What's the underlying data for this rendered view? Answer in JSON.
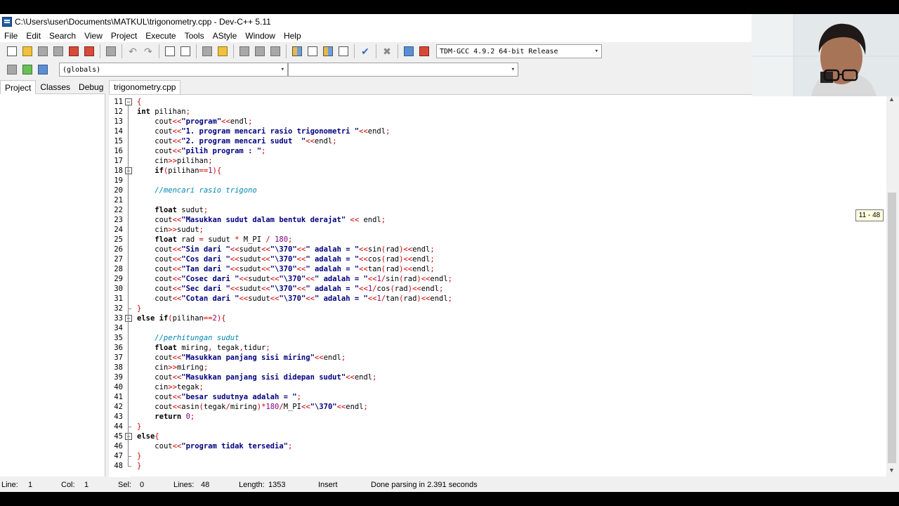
{
  "window": {
    "title": "C:\\Users\\user\\Documents\\MATKUL\\trigonometry.cpp - Dev-C++ 5.11"
  },
  "menu": [
    "File",
    "Edit",
    "Search",
    "View",
    "Project",
    "Execute",
    "Tools",
    "AStyle",
    "Window",
    "Help"
  ],
  "toolbar": {
    "compiler": "TDM-GCC 4.9.2 64-bit Release",
    "scope": "(globals)",
    "member": ""
  },
  "left_tabs": [
    "Project",
    "Classes",
    "Debug"
  ],
  "editor_tab": "trigonometry.cpp",
  "tooltip": "11 - 48",
  "colors": {
    "keyword": "#000000",
    "string": "#00007f",
    "number": "#7f007f",
    "comment": "#0086b3",
    "symbol": "#cc0000",
    "text": "#000000"
  },
  "code": [
    {
      "n": "11",
      "t": "{"
    },
    {
      "n": "12",
      "t": "int pilihan;"
    },
    {
      "n": "13",
      "t": "    cout<<\"program\"<<endl;"
    },
    {
      "n": "14",
      "t": "    cout<<\"1. program mencari rasio trigonometri \"<<endl;"
    },
    {
      "n": "15",
      "t": "    cout<<\"2. program mencari sudut  \"<<endl;"
    },
    {
      "n": "16",
      "t": "    cout<<\"pilih program : \";"
    },
    {
      "n": "17",
      "t": "    cin>>pilihan;"
    },
    {
      "n": "18",
      "t": "    if(pilihan==1){"
    },
    {
      "n": "19",
      "t": ""
    },
    {
      "n": "20",
      "t": "    //mencari rasio trigono"
    },
    {
      "n": "21",
      "t": ""
    },
    {
      "n": "22",
      "t": "    float sudut;"
    },
    {
      "n": "23",
      "t": "    cout<<\"Masukkan sudut dalam bentuk derajat\" << endl;"
    },
    {
      "n": "24",
      "t": "    cin>>sudut;"
    },
    {
      "n": "25",
      "t": "    float rad = sudut * M_PI / 180;"
    },
    {
      "n": "26",
      "t": "    cout<<\"Sin dari \"<<sudut<<\"\\370\"<<\" adalah = \"<<sin(rad)<<endl;"
    },
    {
      "n": "27",
      "t": "    cout<<\"Cos dari \"<<sudut<<\"\\370\"<<\" adalah = \"<<cos(rad)<<endl;"
    },
    {
      "n": "28",
      "t": "    cout<<\"Tan dari \"<<sudut<<\"\\370\"<<\" adalah = \"<<tan(rad)<<endl;"
    },
    {
      "n": "29",
      "t": "    cout<<\"Cosec dari \"<<sudut<<\"\\370\"<<\" adalah = \"<<1/sin(rad)<<endl;"
    },
    {
      "n": "30",
      "t": "    cout<<\"Sec dari \"<<sudut<<\"\\370\"<<\" adalah = \"<<1/cos(rad)<<endl;"
    },
    {
      "n": "31",
      "t": "    cout<<\"Cotan dari \"<<sudut<<\"\\370\"<<\" adalah = \"<<1/tan(rad)<<endl;"
    },
    {
      "n": "32",
      "t": "}"
    },
    {
      "n": "33",
      "t": "else if(pilihan==2){"
    },
    {
      "n": "34",
      "t": ""
    },
    {
      "n": "35",
      "t": "    //perhitungan sudut"
    },
    {
      "n": "36",
      "t": "    float miring, tegak,tidur;"
    },
    {
      "n": "37",
      "t": "    cout<<\"Masukkan panjang sisi miring\"<<endl;"
    },
    {
      "n": "38",
      "t": "    cin>>miring;"
    },
    {
      "n": "39",
      "t": "    cout<<\"Masukkan panjang sisi didepan sudut\"<<endl;"
    },
    {
      "n": "40",
      "t": "    cin>>tegak;"
    },
    {
      "n": "41",
      "t": "    cout<<\"besar sudutnya adalah = \";"
    },
    {
      "n": "42",
      "t": "    cout<<asin(tegak/miring)*180/M_PI<<\"\\370\"<<endl;"
    },
    {
      "n": "43",
      "t": "    return 0;"
    },
    {
      "n": "44",
      "t": "}"
    },
    {
      "n": "45",
      "t": "else{"
    },
    {
      "n": "46",
      "t": "    cout<<\"program tidak tersedia\";"
    },
    {
      "n": "47",
      "t": "}"
    },
    {
      "n": "48",
      "t": "}"
    }
  ],
  "status": {
    "line_label": "Line:",
    "line_value": "1",
    "col_label": "Col:",
    "col_value": "1",
    "sel_label": "Sel:",
    "sel_value": "0",
    "lines_label": "Lines:",
    "lines_value": "48",
    "length_label": "Length:",
    "length_value": "1353",
    "mode": "Insert",
    "message": "Done parsing in 2.391 seconds"
  }
}
